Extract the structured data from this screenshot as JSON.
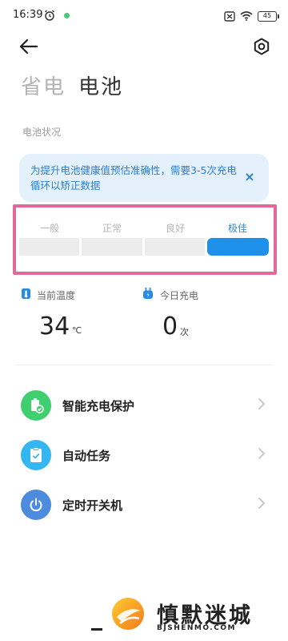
{
  "status_bar": {
    "time": "16:39",
    "battery_level": "45"
  },
  "header": {
    "tab_inactive": "省电",
    "tab_active": "电池"
  },
  "section": {
    "label": "电池状况"
  },
  "banner": {
    "text": "为提升电池健康值预估准确性，需要3-5次充电循环以矫正数据",
    "close": "×"
  },
  "health_meter": {
    "levels": [
      "一般",
      "正常",
      "良好",
      "极佳"
    ],
    "selected_index": 3,
    "accent_color": "#1e90ea"
  },
  "stats": {
    "temperature": {
      "label": "当前温度",
      "value": "34",
      "unit": "℃"
    },
    "charges_today": {
      "label": "今日充电",
      "value": "0",
      "unit": "次"
    }
  },
  "menu": [
    {
      "label": "智能充电保护",
      "icon": "battery-shield-icon",
      "color": "#3fcf6e"
    },
    {
      "label": "自动任务",
      "icon": "clipboard-check-icon",
      "color": "#35b6f0"
    },
    {
      "label": "定时开关机",
      "icon": "power-icon",
      "color": "#4d8bde"
    }
  ],
  "watermark": {
    "title": "慎默迷城",
    "subtitle": "BJSHENMO.COM"
  }
}
